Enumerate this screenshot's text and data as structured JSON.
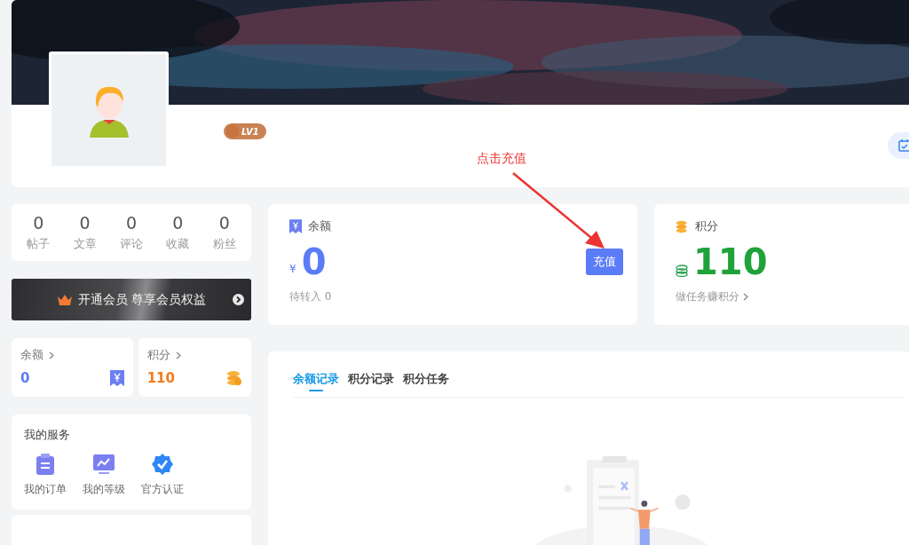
{
  "profile": {
    "level_badge": "LV1"
  },
  "annotation": {
    "text": "点击充值"
  },
  "stats": [
    {
      "value": "0",
      "label": "帖子"
    },
    {
      "value": "0",
      "label": "文章"
    },
    {
      "value": "0",
      "label": "评论"
    },
    {
      "value": "0",
      "label": "收藏"
    },
    {
      "value": "0",
      "label": "粉丝"
    }
  ],
  "vip_banner": {
    "text": "开通会员 尊享会员权益"
  },
  "mini_cards": [
    {
      "kind": "balance",
      "label": "余额",
      "value": "0"
    },
    {
      "kind": "points",
      "label": "积分",
      "value": "110"
    }
  ],
  "services": {
    "title": "我的服务",
    "items": [
      {
        "kind": "order",
        "label": "我的订单"
      },
      {
        "kind": "level",
        "label": "我的等级"
      },
      {
        "kind": "verify",
        "label": "官方认证"
      }
    ]
  },
  "balance_card": {
    "title": "余额",
    "currency": "¥",
    "amount": "0",
    "button": "充值",
    "pending": "待转入 0"
  },
  "points_card": {
    "title": "积分",
    "amount": "110",
    "link": "做任务赚积分"
  },
  "record_tabs": [
    {
      "label": "余额记录",
      "selected": true
    },
    {
      "label": "积分记录",
      "selected": false
    },
    {
      "label": "积分任务",
      "selected": false
    }
  ]
}
